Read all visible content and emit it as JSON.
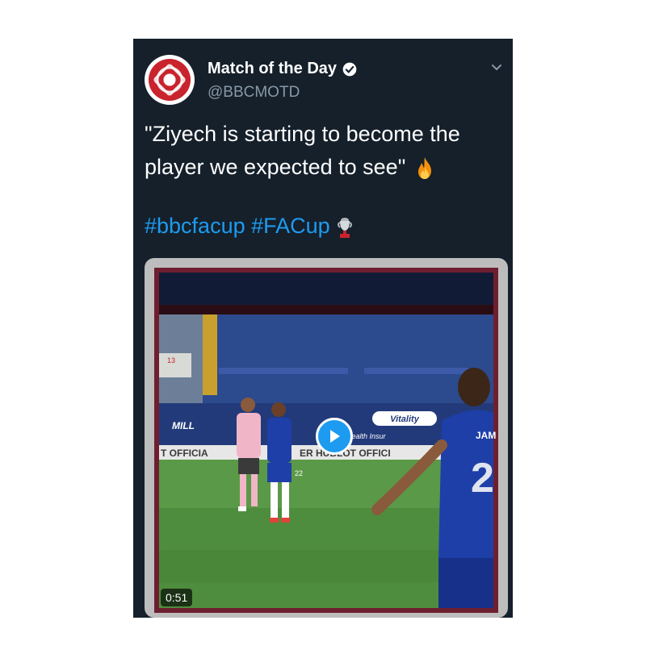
{
  "author": {
    "display_name": "Match of the Day",
    "handle": "@BBCMOTD",
    "verified": true
  },
  "tweet": {
    "text_line1": "\"Ziyech is starting to become the",
    "text_line2": "player we expected to see\"",
    "emoji": "fire-emoji",
    "hashtag1": "#bbcfacup",
    "hashtag2": "#FACup",
    "trophy": "fa-cup-trophy-emoji"
  },
  "media": {
    "duration": "0:51",
    "board_text_1": "MILL",
    "board_text_2": "Vitality",
    "board_text_3": "Health Insur",
    "board_text_4": "T OFFICIA",
    "board_text_5": "ER HUBLOT OFFICI",
    "player_name": "JAM",
    "player_number": "2",
    "player_small_number": "22",
    "stand_number": "13"
  },
  "colors": {
    "background": "#15202b",
    "accent": "#1d9bf0",
    "text": "#ffffff",
    "muted": "#8899a6"
  }
}
